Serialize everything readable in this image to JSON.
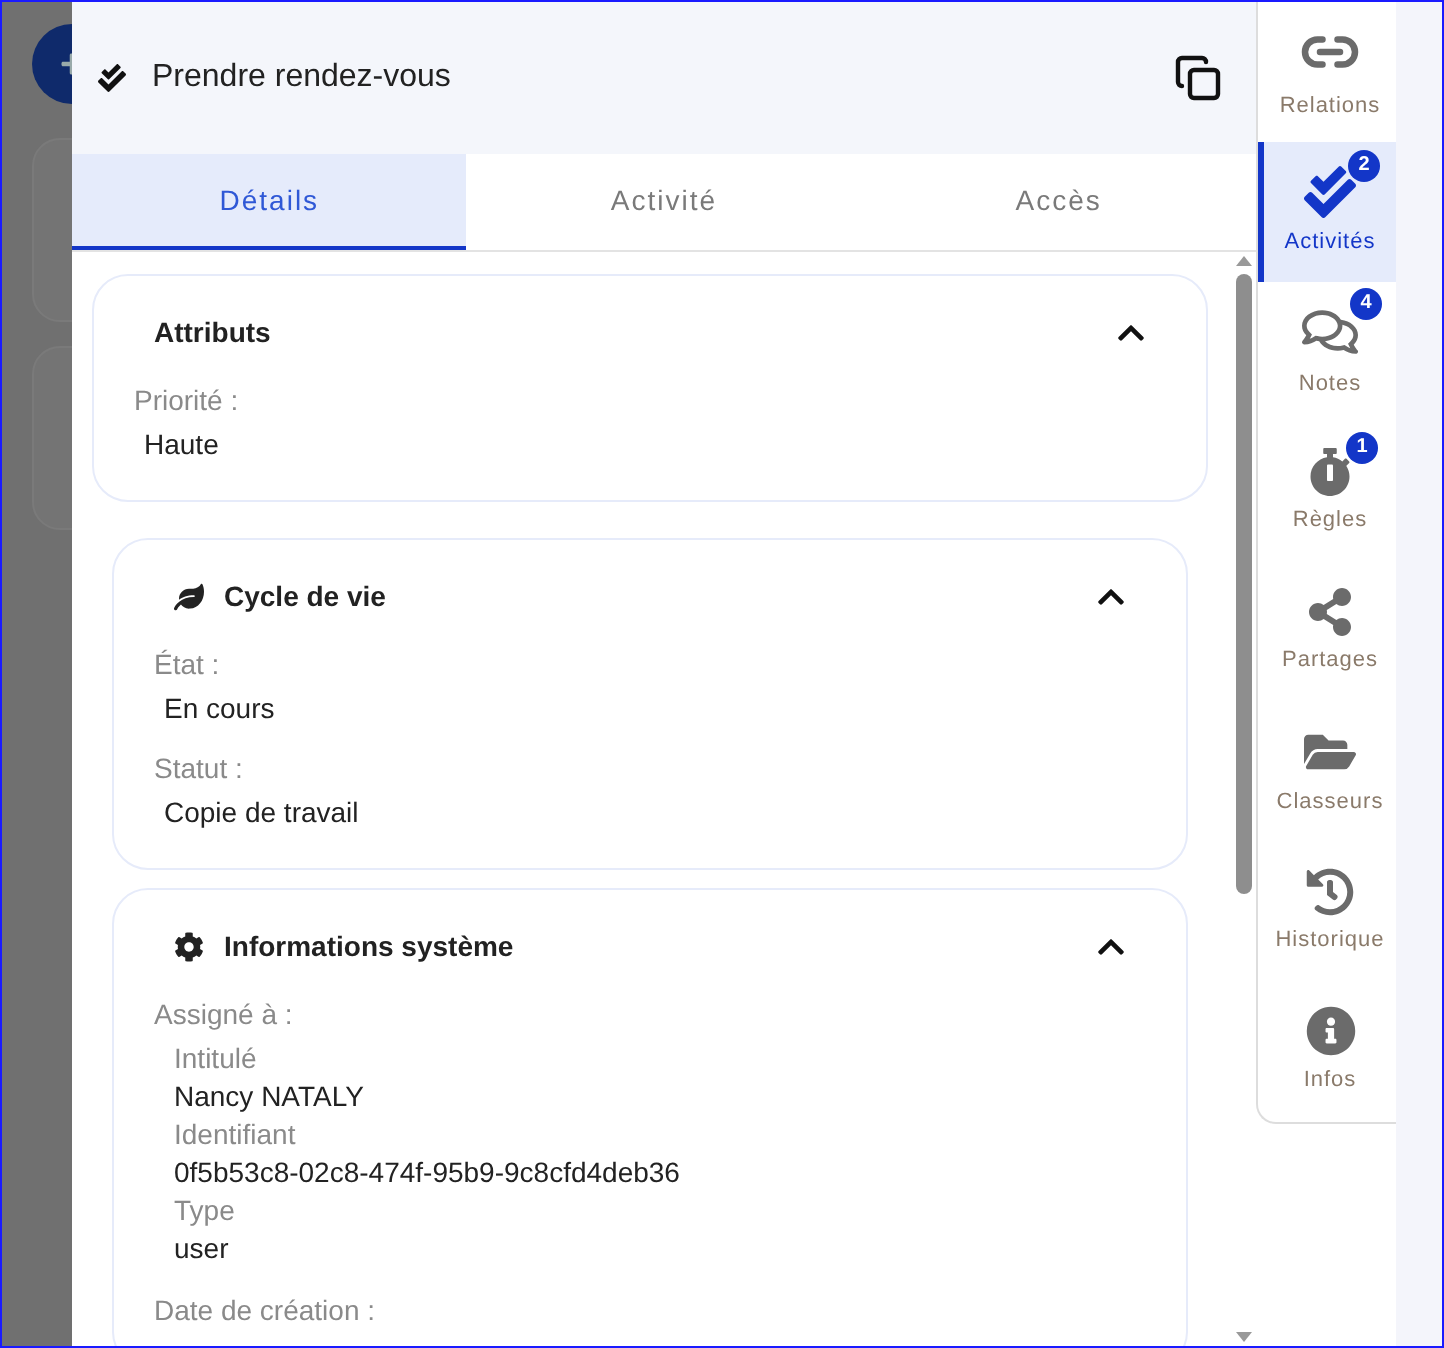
{
  "drawer": {
    "title": "Prendre rendez-vous"
  },
  "tabs": [
    {
      "label": "Détails",
      "selected": true
    },
    {
      "label": "Activité",
      "selected": false
    },
    {
      "label": "Accès",
      "selected": false
    }
  ],
  "cards": [
    {
      "kind": "plain",
      "title": "Attributs",
      "expanded": true,
      "fields": [
        {
          "label": "Priorité :",
          "value": "Haute"
        }
      ]
    },
    {
      "kind": "lifecycle",
      "title": "Cycle de vie",
      "expanded": true,
      "fields": [
        {
          "label": "État :",
          "value": "En cours"
        },
        {
          "label": "Statut :",
          "value": "Copie de travail"
        }
      ]
    },
    {
      "kind": "system",
      "title": "Informations système",
      "expanded": true,
      "fields": [
        {
          "label": "Assigné à :",
          "children": [
            {
              "label": "Intitulé",
              "value": "Nancy NATALY"
            },
            {
              "label": "Identifiant",
              "value": "0f5b53c8-02c8-474f-95b9-9c8cfd4deb36"
            },
            {
              "label": "Type",
              "value": "user"
            }
          ]
        },
        {
          "label": "Date de création :"
        }
      ]
    }
  ],
  "sidebar": {
    "items": [
      {
        "label": "Relations",
        "selected": false
      },
      {
        "label": "Activités",
        "selected": true,
        "badge": "2"
      },
      {
        "label": "Notes",
        "selected": false,
        "badge": "4"
      },
      {
        "label": "Règles",
        "selected": false,
        "badge": "1"
      },
      {
        "label": "Partages",
        "selected": false
      },
      {
        "label": "Classeurs",
        "selected": false
      },
      {
        "label": "Historique",
        "selected": false
      },
      {
        "label": "Infos",
        "selected": false
      }
    ]
  }
}
